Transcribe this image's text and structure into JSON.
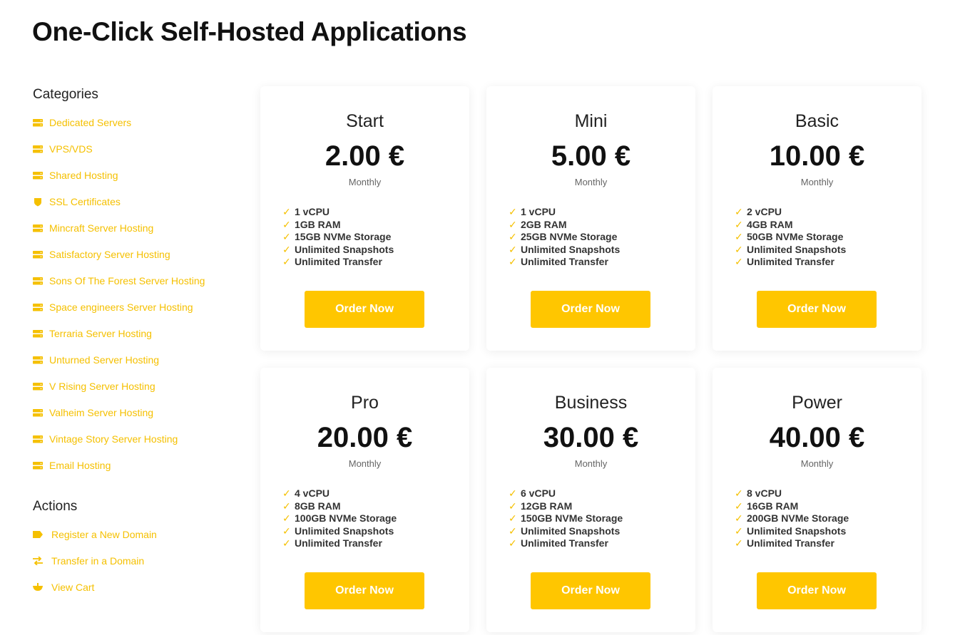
{
  "page": {
    "title": "One-Click Self-Hosted Applications"
  },
  "colors": {
    "accent": "#ffc600",
    "link": "#f5c000",
    "text": "#111111"
  },
  "sidebar": {
    "categories_heading": "Categories",
    "categories": [
      {
        "label": "Dedicated Servers",
        "icon": "server-icon"
      },
      {
        "label": "VPS/VDS",
        "icon": "server-icon"
      },
      {
        "label": "Shared Hosting",
        "icon": "server-icon"
      },
      {
        "label": "SSL Certificates",
        "icon": "shield-icon"
      },
      {
        "label": "Mincraft Server Hosting",
        "icon": "server-icon"
      },
      {
        "label": "Satisfactory Server Hosting",
        "icon": "server-icon"
      },
      {
        "label": "Sons Of The Forest Server Hosting",
        "icon": "server-icon"
      },
      {
        "label": "Space engineers Server Hosting",
        "icon": "server-icon"
      },
      {
        "label": "Terraria Server Hosting",
        "icon": "server-icon"
      },
      {
        "label": "Unturned Server Hosting",
        "icon": "server-icon"
      },
      {
        "label": "V Rising Server Hosting",
        "icon": "server-icon"
      },
      {
        "label": "Valheim Server Hosting",
        "icon": "server-icon"
      },
      {
        "label": "Vintage Story Server Hosting",
        "icon": "server-icon"
      },
      {
        "label": "Email Hosting",
        "icon": "server-icon"
      }
    ],
    "actions_heading": "Actions",
    "actions": [
      {
        "label": "Register a New Domain",
        "icon": "tag-icon"
      },
      {
        "label": "Transfer in a Domain",
        "icon": "transfer-icon"
      },
      {
        "label": "View Cart",
        "icon": "cart-icon"
      }
    ]
  },
  "plans": [
    {
      "name": "Start",
      "price": "2.00 €",
      "period": "Monthly",
      "features": [
        "1 vCPU",
        "1GB RAM",
        "15GB NVMe Storage",
        "Unlimited Snapshots",
        "Unlimited Transfer"
      ],
      "button": "Order Now"
    },
    {
      "name": "Mini",
      "price": "5.00 €",
      "period": "Monthly",
      "features": [
        "1 vCPU",
        "2GB RAM",
        "25GB NVMe Storage",
        "Unlimited Snapshots",
        "Unlimited Transfer"
      ],
      "button": "Order Now"
    },
    {
      "name": "Basic",
      "price": "10.00 €",
      "period": "Monthly",
      "features": [
        "2 vCPU",
        "4GB RAM",
        "50GB NVMe Storage",
        "Unlimited Snapshots",
        "Unlimited Transfer"
      ],
      "button": "Order Now"
    },
    {
      "name": "Pro",
      "price": "20.00 €",
      "period": "Monthly",
      "features": [
        "4 vCPU",
        "8GB RAM",
        "100GB NVMe Storage",
        "Unlimited Snapshots",
        "Unlimited Transfer"
      ],
      "button": "Order Now"
    },
    {
      "name": "Business",
      "price": "30.00 €",
      "period": "Monthly",
      "features": [
        "6 vCPU",
        "12GB RAM",
        "150GB NVMe Storage",
        "Unlimited Snapshots",
        "Unlimited Transfer"
      ],
      "button": "Order Now"
    },
    {
      "name": "Power",
      "price": "40.00 €",
      "period": "Monthly",
      "features": [
        "8 vCPU",
        "16GB RAM",
        "200GB NVMe Storage",
        "Unlimited Snapshots",
        "Unlimited Transfer"
      ],
      "button": "Order Now"
    }
  ]
}
